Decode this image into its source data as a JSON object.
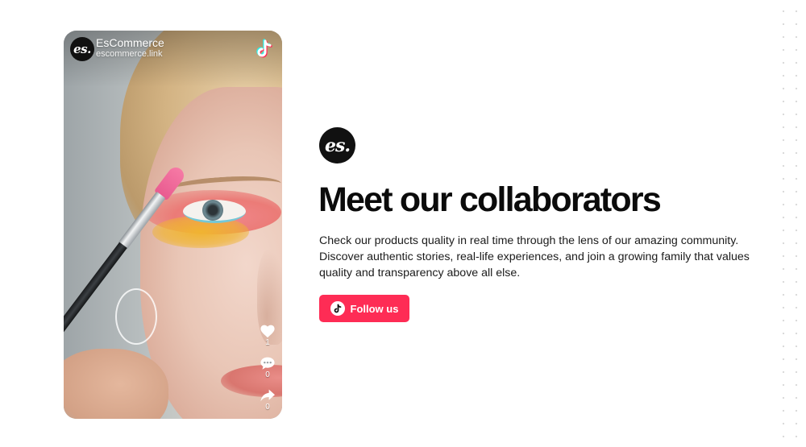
{
  "video_card": {
    "account_name": "EsCommerce",
    "account_link": "escommerce.link",
    "avatar_text": "es.",
    "likes": "1",
    "comments": "0",
    "shares": "0",
    "icons": [
      "tiktok-icon",
      "heart-icon",
      "comment-icon",
      "share-icon"
    ]
  },
  "hero": {
    "logo_text": "es.",
    "title": "Meet our collaborators",
    "description": "Check our products quality in real time through the lens of our amazing community. Discover authentic stories, real-life experiences, and join a growing family that values quality and transparency above all else.",
    "button_label": "Follow us"
  },
  "colors": {
    "accent": "#fe2c55",
    "logo_bg": "#111111",
    "text": "#0b0b0b"
  }
}
